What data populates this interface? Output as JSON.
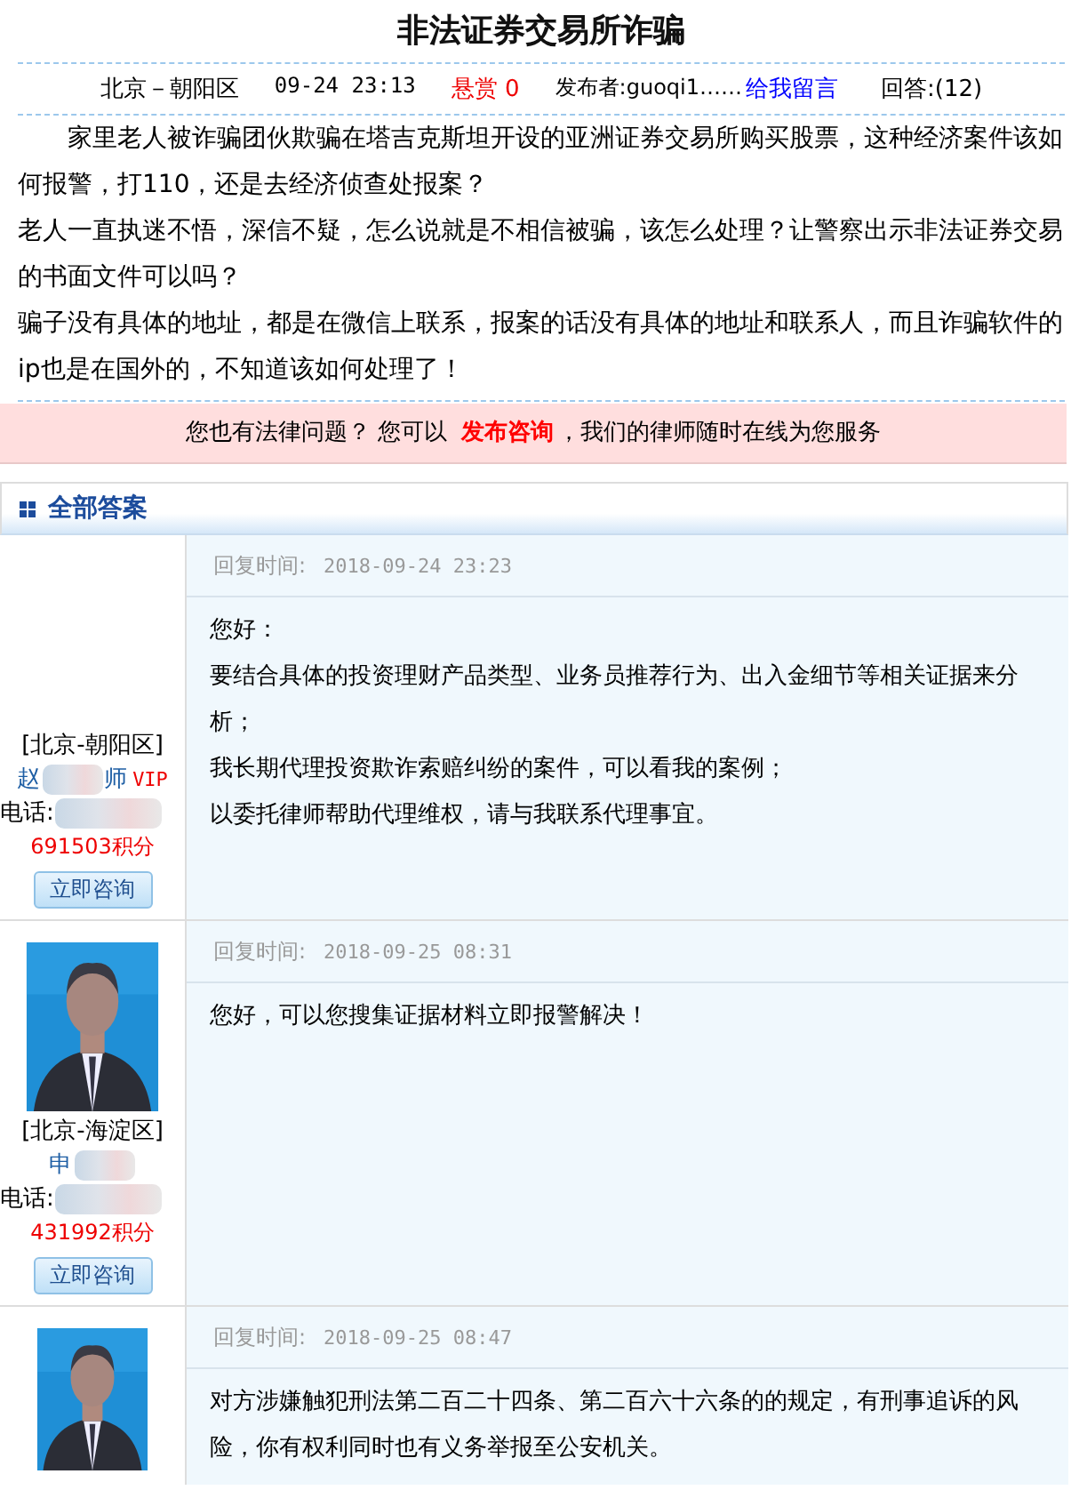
{
  "question": {
    "title": "非法证券交易所诈骗",
    "location": "北京－朝阳区",
    "time": "09-24 23:13",
    "reward_label": "悬赏",
    "reward": "0",
    "publisher": "发布者:guoqi1……",
    "message_link": "给我留言",
    "answers_count": "回答:(12)",
    "paragraphs": [
      "家里老人被诈骗团伙欺骗在塔吉克斯坦开设的亚洲证券交易所购买股票，这种经济案件该如何报警，打110，还是去经济侦查处报案？",
      "老人一直执迷不悟，深信不疑，怎么说就是不相信被骗，该怎么处理？让警察出示非法证券交易的书面文件可以吗？",
      "骗子没有具体的地址，都是在微信上联系，报案的话没有具体的地址和联系人，而且诈骗软件的ip也是在国外的，不知道该如何处理了！"
    ]
  },
  "banner": {
    "before": "您也有法律问题？ 您可以",
    "link": "发布咨询",
    "after": "，我们的律师随时在线为您服务"
  },
  "section_title": "全部答案",
  "answers": [
    {
      "photo": false,
      "region": "[北京-朝阳区]",
      "name_parts": [
        "赵",
        "师"
      ],
      "badge": "VIP",
      "phone_label": "电话:",
      "points": "691503积分",
      "button": "立即咨询",
      "time_label": "回复时间:",
      "time": "2018-09-24 23:23",
      "paragraphs": [
        "您好：",
        "要结合具体的投资理财产品类型、业务员推荐行为、出入金细节等相关证据来分析；",
        "我长期代理投资欺诈索赔纠纷的案件，可以看我的案例；",
        "以委托律师帮助代理维权，请与我联系代理事宜。"
      ]
    },
    {
      "photo": true,
      "region": "[北京-海淀区]",
      "name_parts": [
        "申"
      ],
      "phone_label": "电话:",
      "points": "431992积分",
      "button": "立即咨询",
      "time_label": "回复时间:",
      "time": "2018-09-25 08:31",
      "paragraphs": [
        "您好，可以您搜集证据材料立即报警解决！"
      ]
    },
    {
      "photo": true,
      "time_label": "回复时间:",
      "time": "2018-09-25 08:47",
      "paragraphs": [
        "对方涉嫌触犯刑法第二百二十四条、第二百六十六条的的规定，有刑事追诉的风险，你有权利同时也有义务举报至公安机关。"
      ]
    }
  ]
}
